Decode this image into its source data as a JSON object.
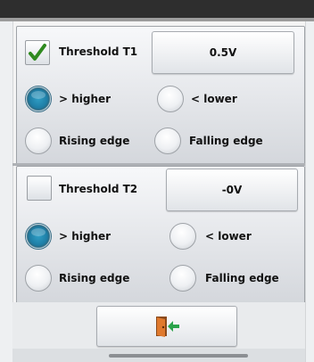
{
  "threshold1": {
    "enabled": true,
    "label": "Threshold T1",
    "value": "0.5V",
    "options": {
      "higher": "> higher",
      "lower": "< lower",
      "rising": "Rising edge",
      "falling": "Falling edge"
    },
    "selected": "higher"
  },
  "threshold2": {
    "enabled": false,
    "label": "Threshold T2",
    "value": "-0V",
    "options": {
      "higher": "> higher",
      "lower": "< lower",
      "rising": "Rising edge",
      "falling": "Falling edge"
    },
    "selected": "higher"
  },
  "footer": {
    "exit_icon": "exit-door-icon"
  },
  "colors": {
    "check": "#2f8a1f",
    "radio_selected": "#1e7ea6",
    "exit_arrow": "#2aa34a",
    "door": "#d2661f"
  }
}
